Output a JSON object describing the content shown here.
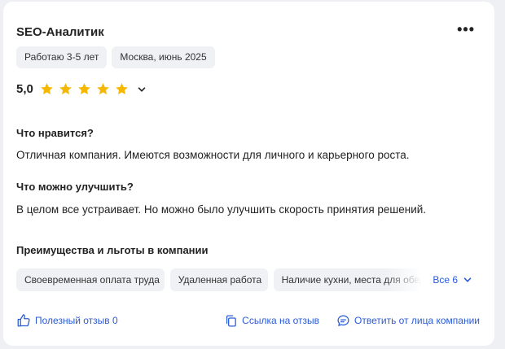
{
  "review": {
    "title": "SEO-Аналитик",
    "tags": [
      "Работаю 3-5 лет",
      "Москва, июнь 2025"
    ],
    "rating": {
      "value": "5,0",
      "stars": 5
    },
    "likes": {
      "title": "Что нравится?",
      "text": "Отличная компания. Имеются возможности для личного и карьерного роста."
    },
    "improve": {
      "title": "Что можно улучшить?",
      "text": "В целом все устраивает. Но можно было улучшить скорость принятия решений."
    },
    "benefits": {
      "title": "Преимущества и льготы в компании",
      "items": [
        "Своевременная оплата труда",
        "Удаленная работа",
        "Наличие кухни, места для обеда"
      ],
      "all_label": "Все 6"
    },
    "actions": {
      "helpful": "Полезный отзыв 0",
      "link": "Ссылка на отзыв",
      "reply": "Ответить от лица компании"
    },
    "more_label": "•••",
    "colors": {
      "accent": "#2a5bd7",
      "star": "#f5b800",
      "chip_bg": "#eff1f4"
    }
  }
}
